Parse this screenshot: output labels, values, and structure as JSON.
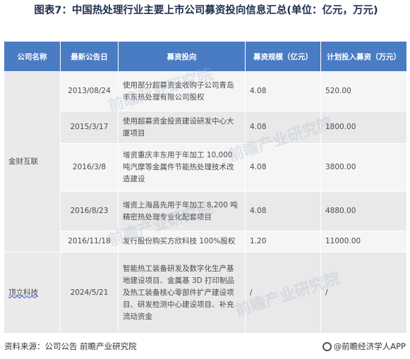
{
  "title": "图表7：中国热处理行业主要上市公司募资投向信息汇总(单位：亿元，万元)",
  "table": {
    "headers": [
      "公司名称",
      "最新公告日",
      "募资投向",
      "募资规模（亿元）",
      "计划投入募资（万元）"
    ],
    "groups": [
      {
        "company": "金财互联",
        "rows": [
          {
            "date": "2013/08/24",
            "purpose": "使用部分超募资金收购子公司青岛丰东热处理有限公司股权",
            "scale": "4.08",
            "planned": "520.00"
          },
          {
            "date": "2015/3/17",
            "purpose": "使用超募资金投资建设研发中心大厦项目",
            "scale": "4.08",
            "planned": "1800.00"
          },
          {
            "date": "2016/3/8",
            "purpose": "增资重庆丰东用于年加工 10,000 吨汽摩等金属件节能热处理技术改造建设",
            "scale": "4.08",
            "planned": "3800.00"
          },
          {
            "date": "2016/8/23",
            "purpose": "增资上海昌先用于年加工 8,200 吨精密热处理专业化配套项目",
            "scale": "4.08",
            "planned": "4880.00"
          },
          {
            "date": "2016/11/18",
            "purpose": "发行股份购买方欣科技 100%股权",
            "scale": "1.20",
            "planned": "11000.00"
          }
        ]
      },
      {
        "company": "顶立科技",
        "rows": [
          {
            "date": "2024/5/21",
            "purpose": "智能热工装备研发及数字化生产基地建设项目、金属基 3D 打印制品及热工装备核心零部件扩产建设项目、研发检测中心建设项目、补充流动资金",
            "scale": "/",
            "planned": "/"
          }
        ]
      }
    ]
  },
  "footer": {
    "source": "资料来源：公司公告 前瞻产业研究院",
    "brand": "@前瞻经济学人APP"
  },
  "watermark": "前瞻产业研究院"
}
